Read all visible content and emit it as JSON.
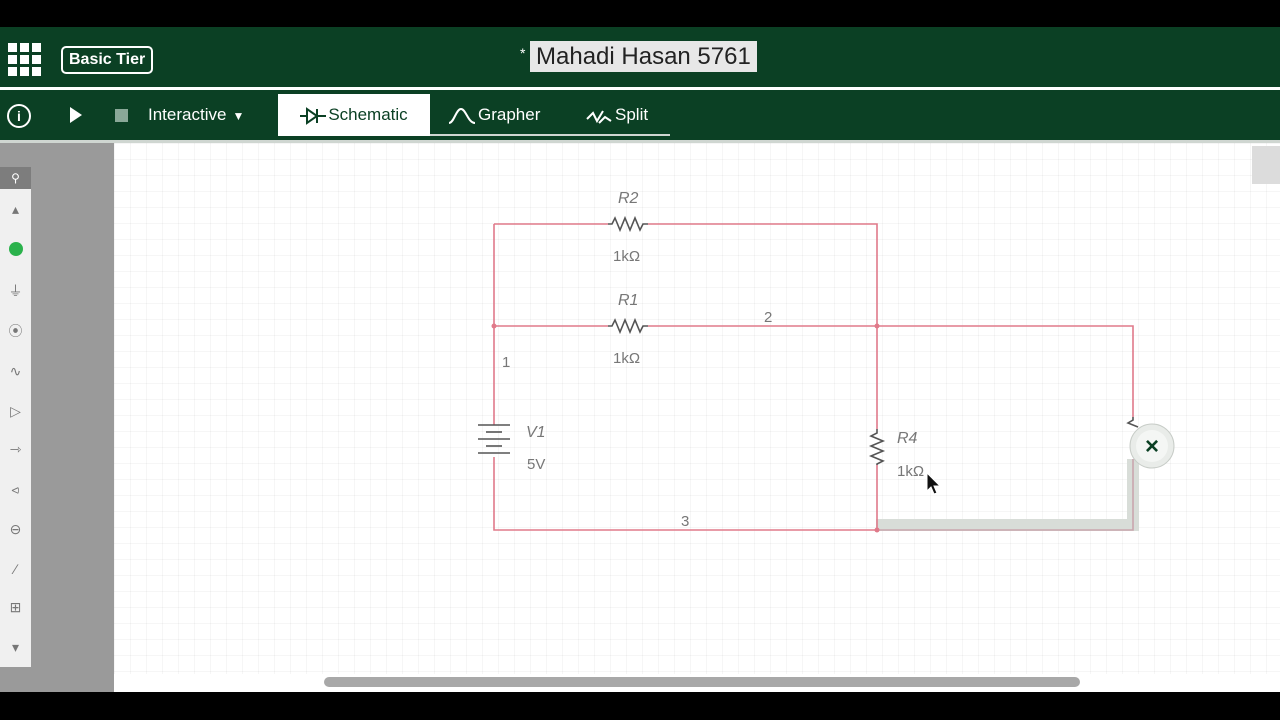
{
  "header": {
    "tier_badge": "Basic Tier",
    "title_marker": "*",
    "title": "Mahadi Hasan 5761"
  },
  "toolbar": {
    "info": "i",
    "mode": "Interactive",
    "tabs": [
      {
        "label": "Schematic",
        "icon": "diode-icon",
        "active": true
      },
      {
        "label": "Grapher",
        "icon": "sine-wave-icon",
        "active": false
      },
      {
        "label": "Split",
        "icon": "split-icon",
        "active": false
      }
    ]
  },
  "palette": {
    "icons": [
      "search-icon",
      "scroll-up-icon",
      "probe-icon",
      "ground-icon",
      "voltage-source-icon",
      "resistor-icon",
      "opamp-icon",
      "diode-icon",
      "transistor-icon",
      "meter-icon",
      "switch-icon",
      "chip-icon",
      "scroll-down-icon"
    ]
  },
  "schematic": {
    "components": [
      {
        "ref": "R2",
        "value": "1kΩ",
        "type": "resistor"
      },
      {
        "ref": "R1",
        "value": "1kΩ",
        "type": "resistor"
      },
      {
        "ref": "R4",
        "value": "1kΩ",
        "type": "resistor"
      },
      {
        "ref": "V1",
        "value": "5V",
        "type": "battery"
      }
    ],
    "nodes": [
      "1",
      "2",
      "3"
    ],
    "delete_tooltip": "×"
  },
  "colors": {
    "brand_green": "#0b4024",
    "wire": "#e07a8a",
    "selection": "#d8ddd8"
  }
}
